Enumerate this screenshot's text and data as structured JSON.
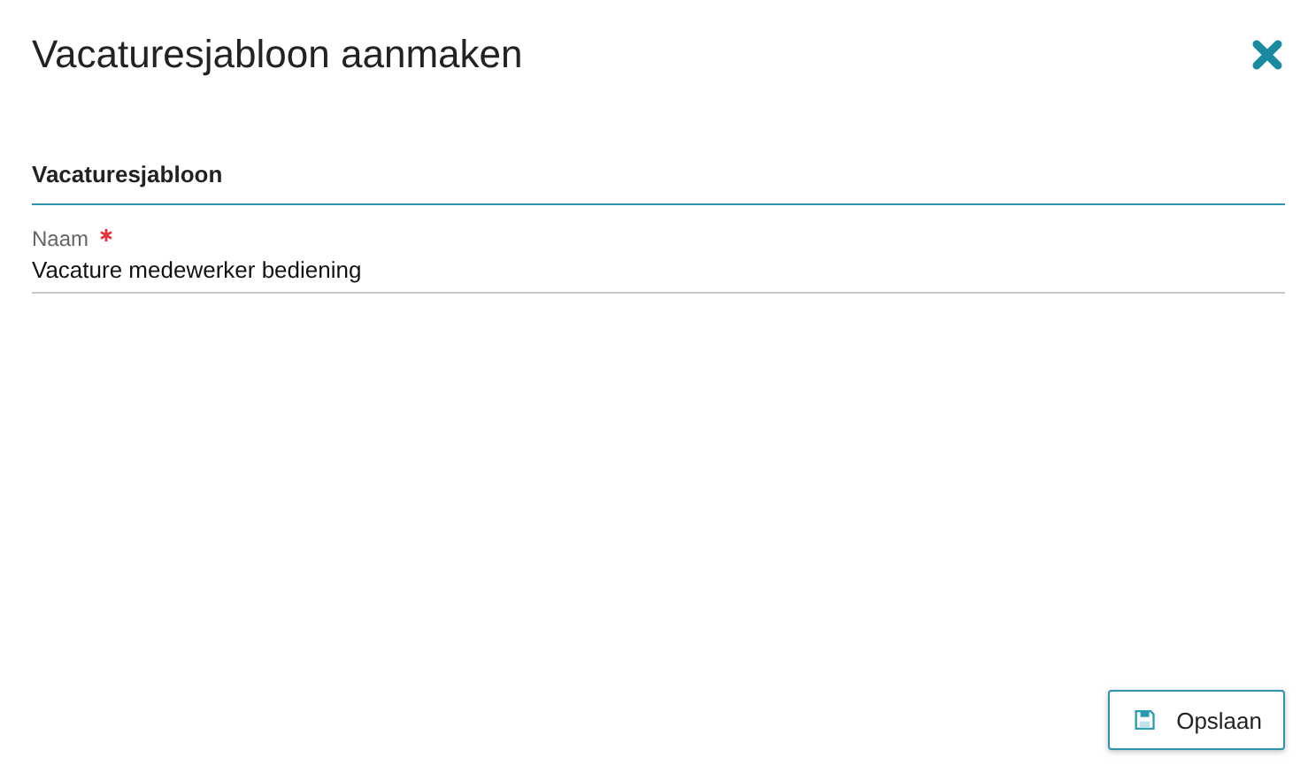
{
  "dialog": {
    "title": "Vacaturesjabloon aanmaken"
  },
  "section": {
    "title": "Vacaturesjabloon"
  },
  "fields": [
    {
      "label": "Naam",
      "required": true,
      "value": "Vacature medewerker bediening"
    }
  ],
  "buttons": [
    {
      "label": "Opslaan",
      "kind": "save"
    }
  ]
}
